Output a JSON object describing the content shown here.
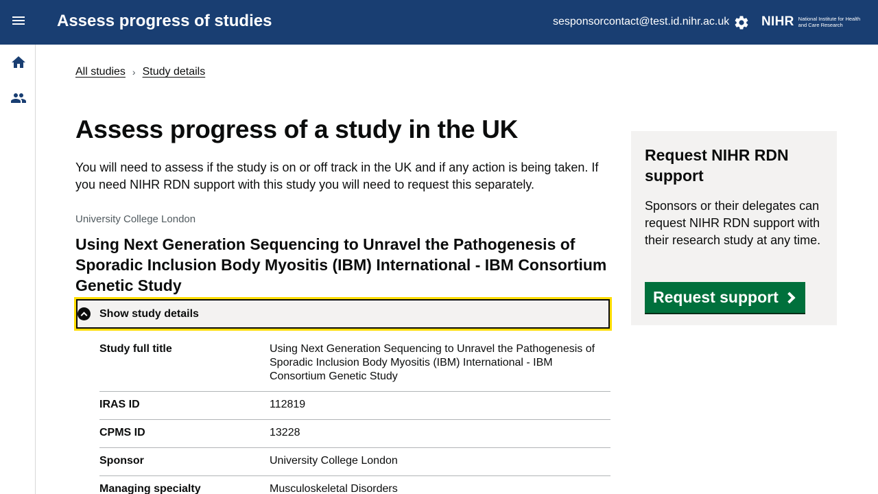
{
  "header": {
    "app_title": "Assess progress of studies",
    "user_email": "sesponsorcontact@test.id.nihr.ac.uk",
    "logo_mark": "NIHR",
    "logo_subtitle": "National Institute for Health and Care Research",
    "brand_color": "#193e72",
    "icons": [
      "menu-icon",
      "gear-icon"
    ]
  },
  "sidenav": {
    "items": [
      {
        "icon": "home-icon"
      },
      {
        "icon": "people-icon"
      }
    ]
  },
  "breadcrumb": {
    "items": [
      "All studies",
      "Study details"
    ]
  },
  "main": {
    "page_title": "Assess progress of a study in the UK",
    "intro": "You will need to assess if the study is on or off track in the UK and if any action is being taken. If you need NIHR RDN support with this study you will need to request this separately.",
    "organisation": "University College London",
    "study_title": "Using Next Generation Sequencing to Unravel the Pathogenesis of Sporadic Inclusion Body Myositis (IBM) International - IBM Consortium Genetic Study",
    "details_toggle_label": "Show study details",
    "details": [
      {
        "key": "Study full title",
        "value": "Using Next Generation Sequencing to Unravel the Pathogenesis of Sporadic Inclusion Body Myositis (IBM) International - IBM Consortium Genetic Study"
      },
      {
        "key": "IRAS ID",
        "value": "112819"
      },
      {
        "key": "CPMS ID",
        "value": "13228"
      },
      {
        "key": "Sponsor",
        "value": "University College London"
      },
      {
        "key": "Managing specialty",
        "value": "Musculoskeletal Disorders"
      }
    ]
  },
  "aside": {
    "title": "Request NIHR RDN support",
    "body": "Sponsors or their delegates can request NIHR RDN support with their research study at any time.",
    "button_label": "Request support",
    "button_color": "#00703c"
  }
}
